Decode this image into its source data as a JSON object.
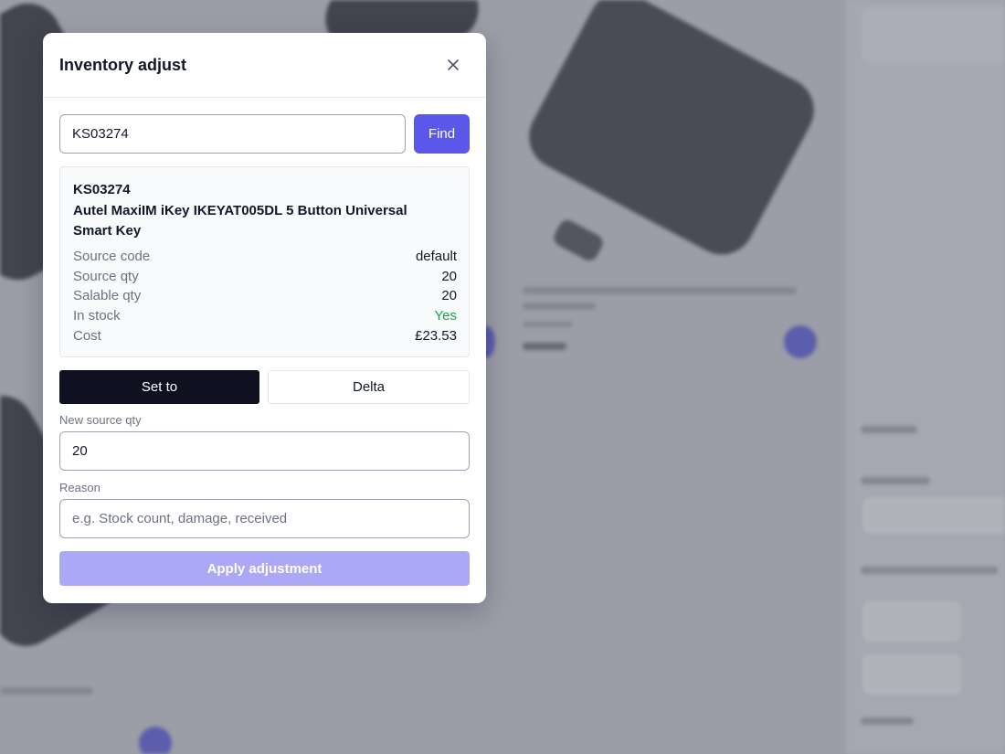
{
  "modal": {
    "title": "Inventory adjust",
    "search": {
      "value": "KS03274",
      "find_label": "Find"
    },
    "product": {
      "sku": "KS03274",
      "name": "Autel MaxiIM iKey IKEYAT005DL 5 Button Universal Smart Key",
      "details": [
        {
          "label": "Source code",
          "value": "default"
        },
        {
          "label": "Source qty",
          "value": "20"
        },
        {
          "label": "Salable qty",
          "value": "20"
        },
        {
          "label": "In stock",
          "value": "Yes"
        },
        {
          "label": "Cost",
          "value": "£23.53"
        }
      ]
    },
    "mode": {
      "active": "Set to",
      "set_to_label": "Set to",
      "delta_label": "Delta"
    },
    "new_qty": {
      "label": "New source qty",
      "value": "20"
    },
    "reason": {
      "label": "Reason",
      "placeholder": "e.g. Stock count, damage, received",
      "value": ""
    },
    "apply_label": "Apply adjustment"
  },
  "colors": {
    "accent": "#5b57ea",
    "accent_disabled": "#aba8f6",
    "active_mode": "#0f1020",
    "in_stock": "#16a34a"
  },
  "icons": {
    "close": "close-icon"
  }
}
